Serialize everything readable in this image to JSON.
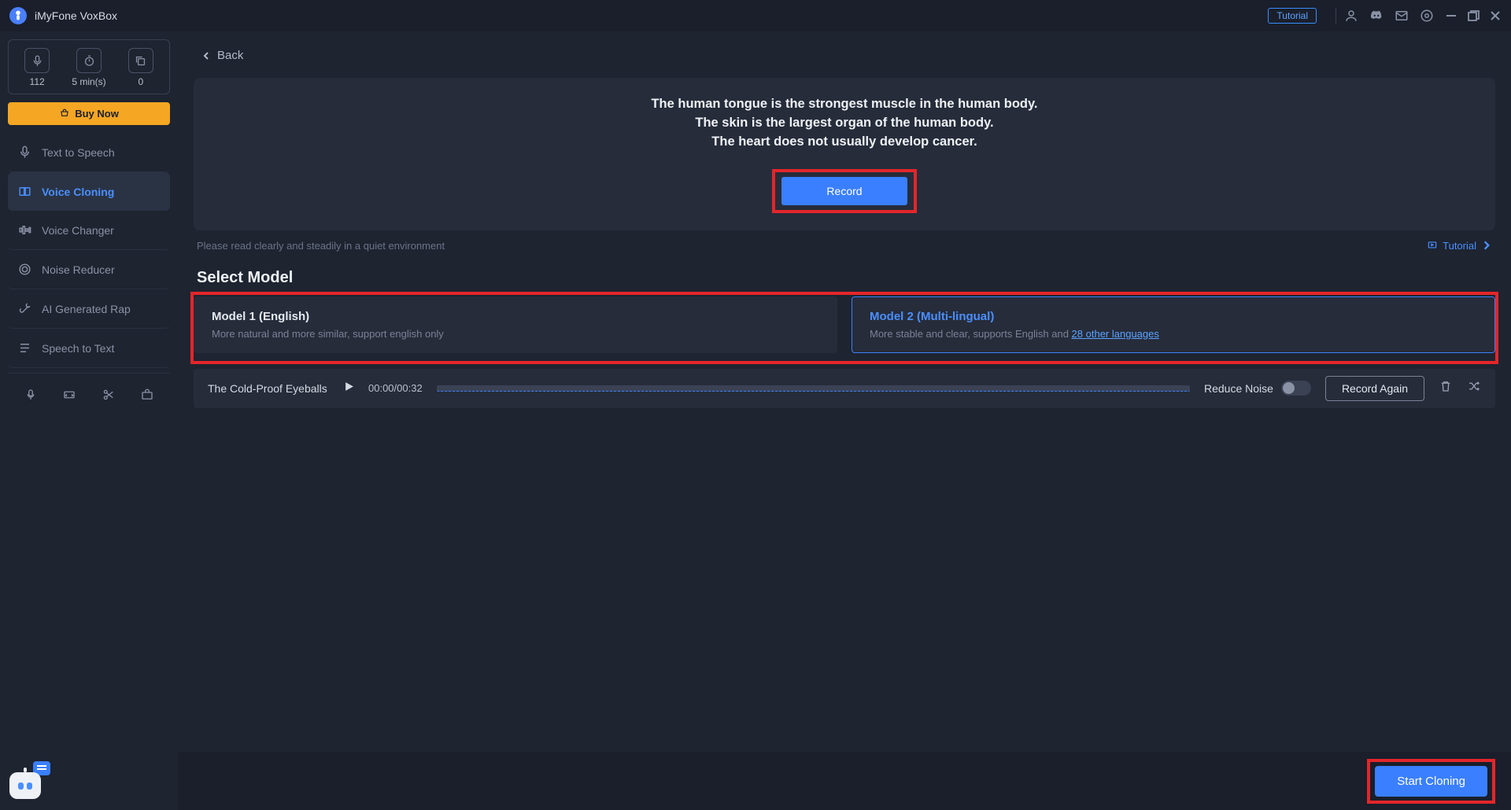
{
  "app_title": "iMyFone VoxBox",
  "titlebar": {
    "tutorial": "Tutorial"
  },
  "credits": {
    "chars": "112",
    "minutes": "5 min(s)",
    "converts": "0",
    "buy_now": "Buy Now"
  },
  "sidebar": {
    "items": [
      {
        "label": "Text to Speech"
      },
      {
        "label": "Voice Cloning"
      },
      {
        "label": "Voice Changer"
      },
      {
        "label": "Noise Reducer"
      },
      {
        "label": "AI Generated Rap"
      },
      {
        "label": "Speech to Text"
      }
    ]
  },
  "back_label": "Back",
  "reading": {
    "line1": "The human tongue is the strongest muscle in the human body.",
    "line2": "The skin is the largest organ of the human body.",
    "line3": "The heart does not usually develop cancer.",
    "record_button": "Record"
  },
  "hint": "Please read clearly and steadily in a quiet environment",
  "tutorial_link": "Tutorial",
  "section_title": "Select Model",
  "models": {
    "m1": {
      "title": "Model 1 (English)",
      "desc": "More natural and more similar, support english only"
    },
    "m2": {
      "title": "Model 2 (Multi-lingual)",
      "desc_prefix": "More stable and clear, supports English and ",
      "link": "28 other languages"
    }
  },
  "player": {
    "track": "The Cold-Proof Eyeballs",
    "time": "00:00/00:32",
    "reduce_noise": "Reduce Noise",
    "record_again": "Record Again"
  },
  "start_button": "Start Cloning"
}
